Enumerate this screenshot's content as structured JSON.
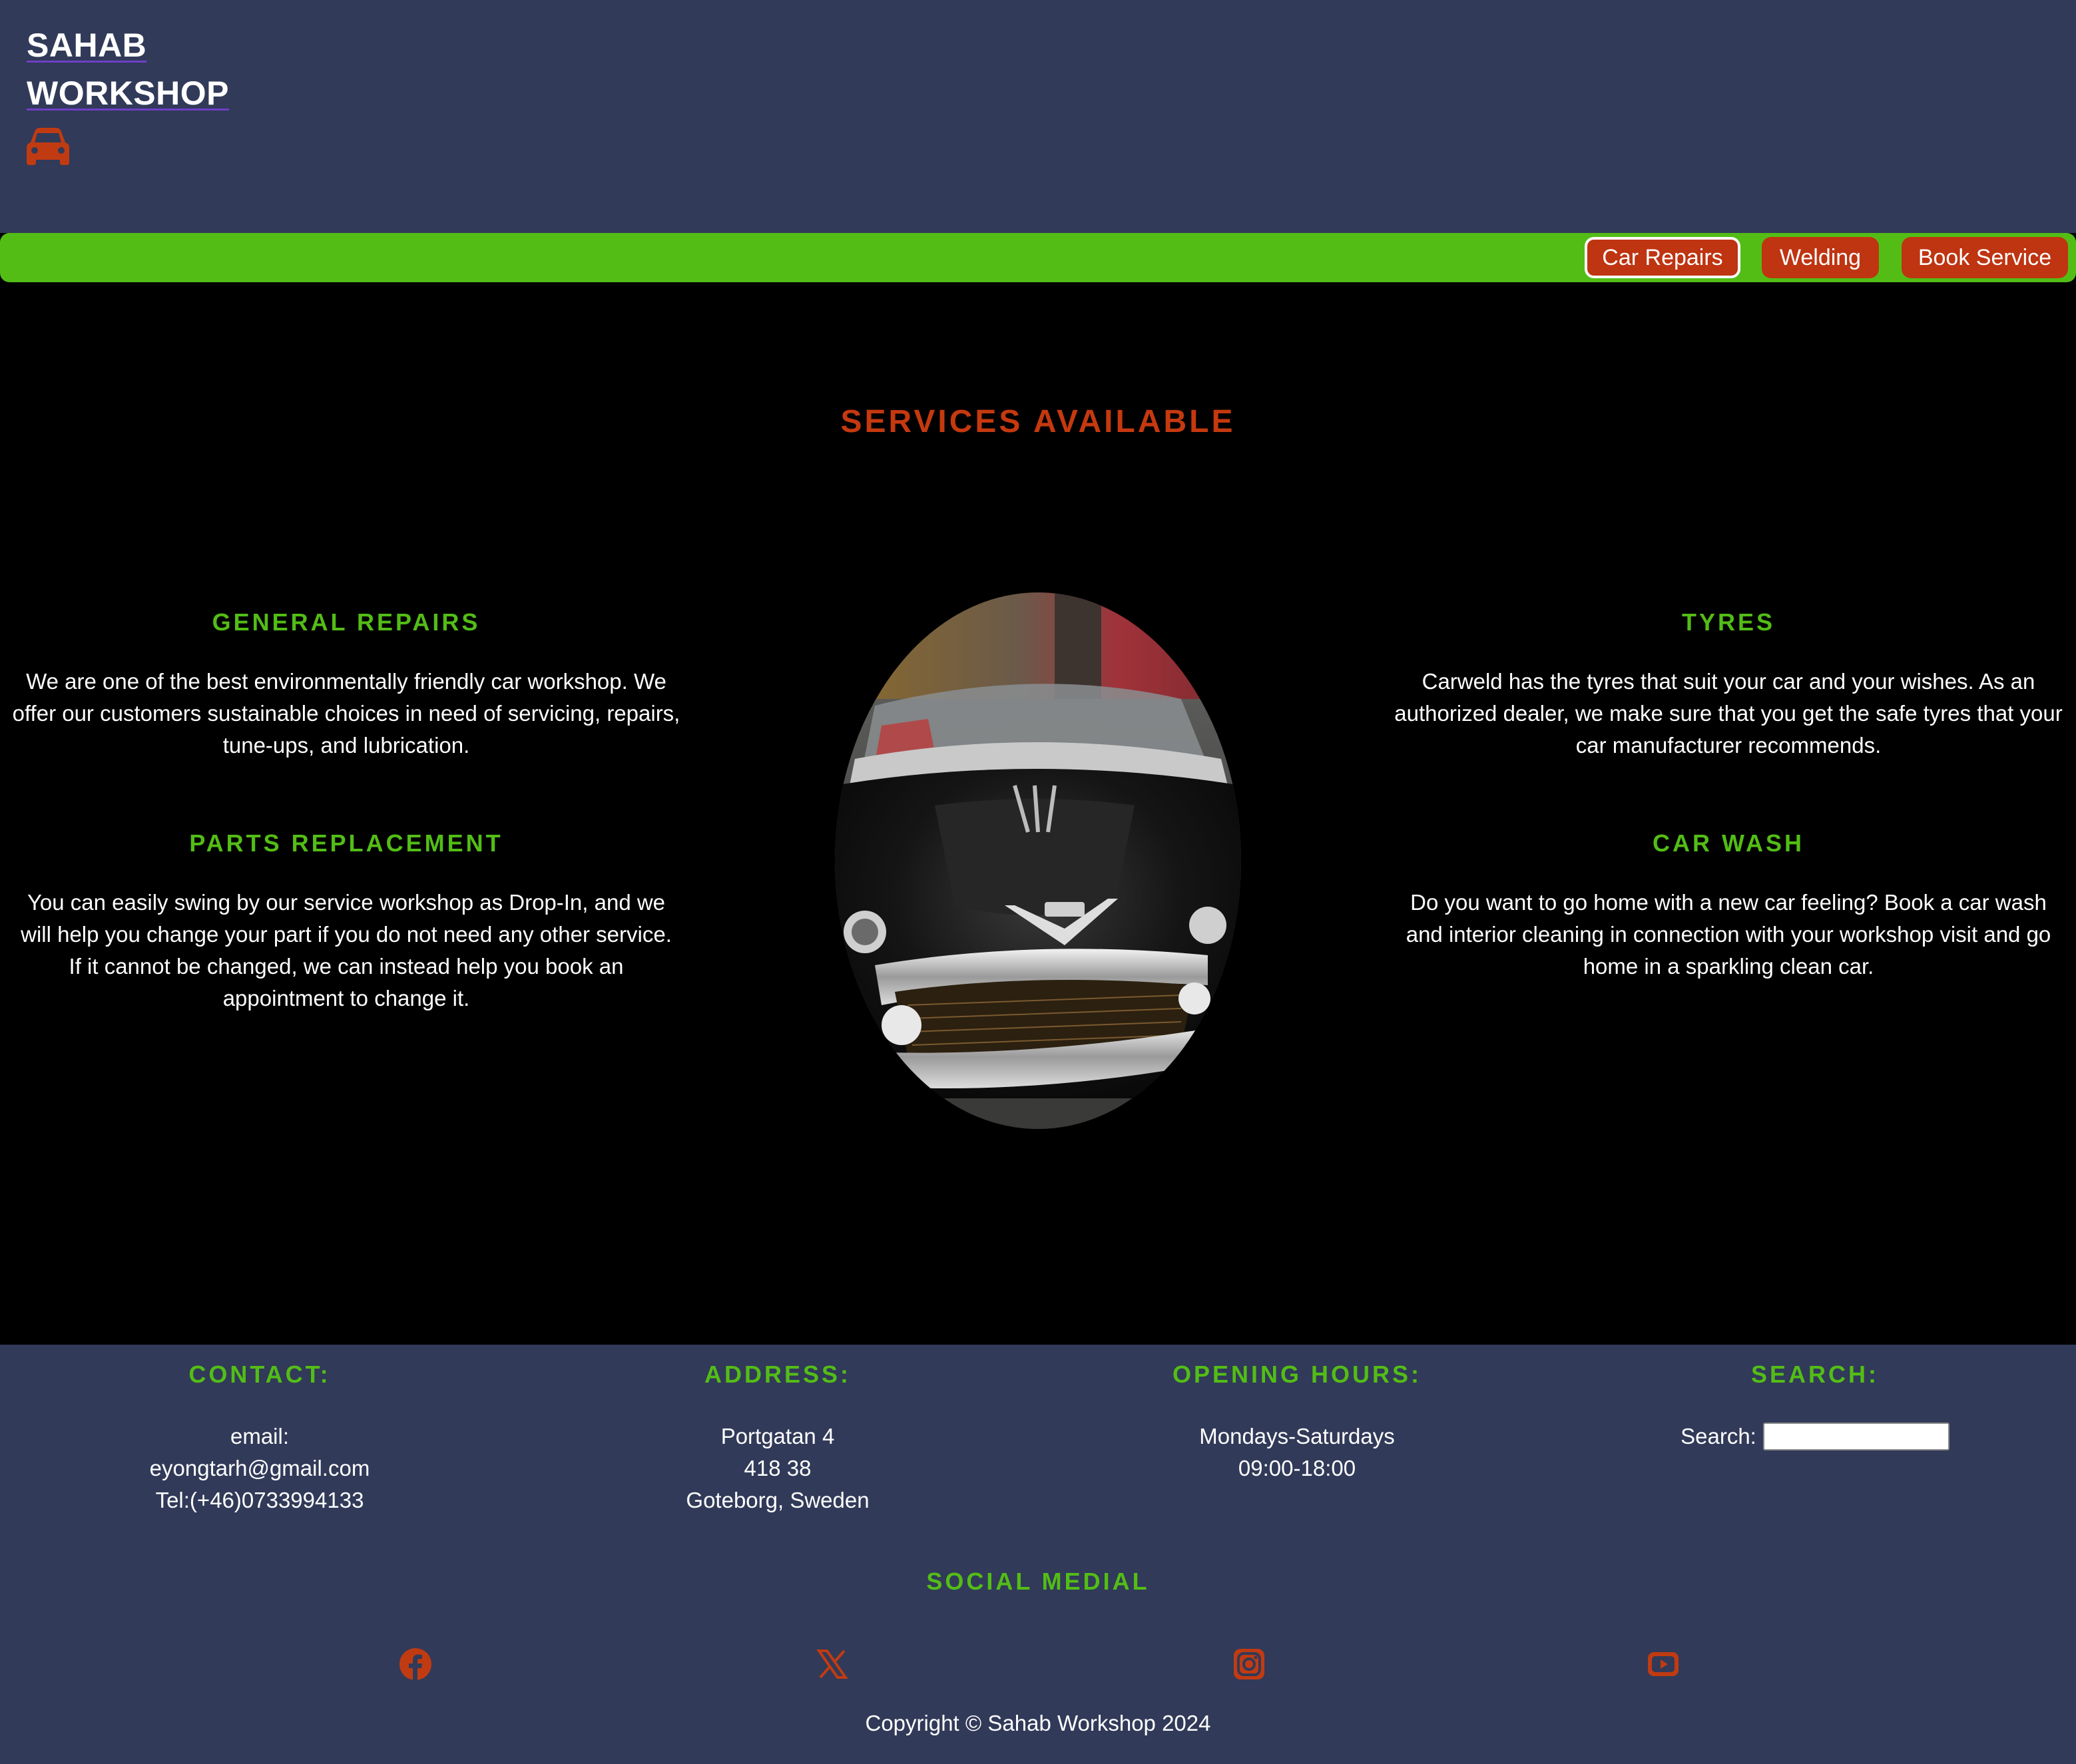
{
  "header": {
    "brand_line1": "SAHAB",
    "brand_line2": "WORKSHOP",
    "logo_icon": "car-icon"
  },
  "nav": {
    "items": [
      {
        "label": "Car Repairs",
        "active": true
      },
      {
        "label": "Welding",
        "active": false
      },
      {
        "label": "Book Service",
        "active": false
      }
    ]
  },
  "services": {
    "title": "SERVICES AVAILABLE",
    "general_repairs": {
      "heading": "GENERAL REPAIRS",
      "text": "We are one of the best environmentally friendly car workshop. We offer our customers sustainable choices in need of servicing, repairs, tune-ups, and lubrication."
    },
    "parts_replacement": {
      "heading": "PARTS REPLACEMENT",
      "text": "You can easily swing by our service workshop as Drop-In, and we will help you change your part if you do not need any other service. If it cannot be changed, we can instead help you book an appointment to change it."
    },
    "tyres": {
      "heading": "TYRES",
      "text": "Carweld has the tyres that suit your car and your wishes. As an authorized dealer, we make sure that you get the safe tyres that your car manufacturer recommends."
    },
    "car_wash": {
      "heading": "CAR WASH",
      "text": "Do you want to go home with a new car feeling? Book a car wash and interior cleaning in connection with your workshop visit and go home in a sparkling clean car."
    }
  },
  "footer": {
    "contact": {
      "heading": "CONTACT:",
      "line1": "email:",
      "line2": "eyongtarh@gmail.com",
      "line3": "Tel:(+46)0733994133"
    },
    "address": {
      "heading": "ADDRESS:",
      "line1": "Portgatan 4",
      "line2": "418 38",
      "line3": "Goteborg, Sweden"
    },
    "hours": {
      "heading": "OPENING HOURS:",
      "line1": "Mondays-Saturdays",
      "line2": "09:00-18:00"
    },
    "search": {
      "heading": "SEARCH:",
      "label": "Search:",
      "value": ""
    },
    "social_title": "SOCIAL MEDIAL",
    "social_icons": [
      "facebook-icon",
      "x-icon",
      "instagram-icon",
      "youtube-icon"
    ],
    "copyright": "Copyright © Sahab Workshop 2024"
  },
  "colors": {
    "header_bg": "#313a58",
    "nav_green": "#53bd16",
    "accent_red": "#bf3411",
    "main_bg": "#000000"
  }
}
